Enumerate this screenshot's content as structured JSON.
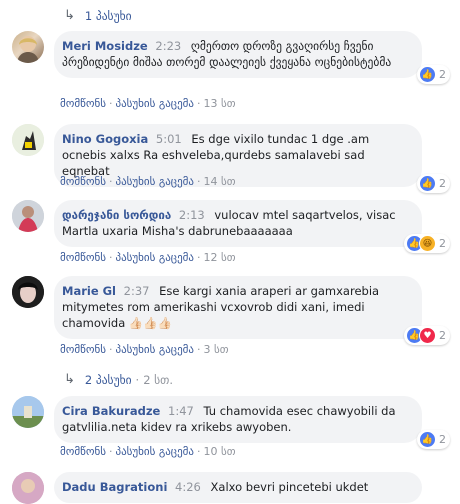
{
  "thread": {
    "top_reply_toggle": {
      "arrow": "↳",
      "label": "1 პასუხი"
    },
    "mid_reply_toggle": {
      "arrow": "↳",
      "label": "2 პასუხი",
      "sep": "·",
      "time": "2 სთ."
    },
    "action_like": "მომწონს",
    "action_reply": "პასუხის გაცემა",
    "comments": [
      {
        "author": "Meri Mosidze",
        "time": "2:23",
        "text": "ღმერთო დროზე გვაღირსე ჩვენი პრეზიდენტი მიშაა თორემ დაალეიეს ქვეყანა ოცნებისტებმა",
        "age": "13 სთ",
        "reactions": [
          "like"
        ],
        "count": "2"
      },
      {
        "author": "Nino Gogoxia",
        "time": "5:01",
        "text": "Es dge vixilo tundac 1 dge .am ocnebis xalxs Ra eshveleba,qurdebs samalavebi sad eqnebat",
        "age": "14 სთ",
        "reactions": [
          "like"
        ],
        "count": "2"
      },
      {
        "author": "დარეჯანი სორდია",
        "time": "2:13",
        "text": "vulocav mtel saqartvelos, visac Martla uxaria Misha's dabrunebaaaaaaa",
        "age": "12 სთ",
        "reactions": [
          "like",
          "haha"
        ],
        "count": "2"
      },
      {
        "author": "Marie Gl",
        "time": "2:37",
        "text": "Ese kargi xania araperi ar gamxarebia mitymetes rom amerikashi vcxovrob didi xani, imedi chamovida 👍🏻👍🏻👍🏻",
        "age": "3 სთ",
        "reactions": [
          "like",
          "love"
        ],
        "count": "2"
      },
      {
        "author": "Cira Bakuradze",
        "time": "1:47",
        "text": "Tu chamovida esec chawyobili da gatvlilia.neta kidev ra xrikebs awyoben.",
        "age": "10 სთ",
        "reactions": [
          "like"
        ],
        "count": "2"
      },
      {
        "author": "Dadu Bagrationi",
        "time": "4:26",
        "text": "Xalxo bevri pincetebi ukdet",
        "age": "",
        "reactions": [],
        "count": ""
      }
    ]
  },
  "colors": {
    "link": "#385898",
    "meta": "#90949c",
    "bubble": "#f2f3f5",
    "like": "#4d7bf3",
    "love": "#f0284a",
    "haha": "#f7b125"
  }
}
